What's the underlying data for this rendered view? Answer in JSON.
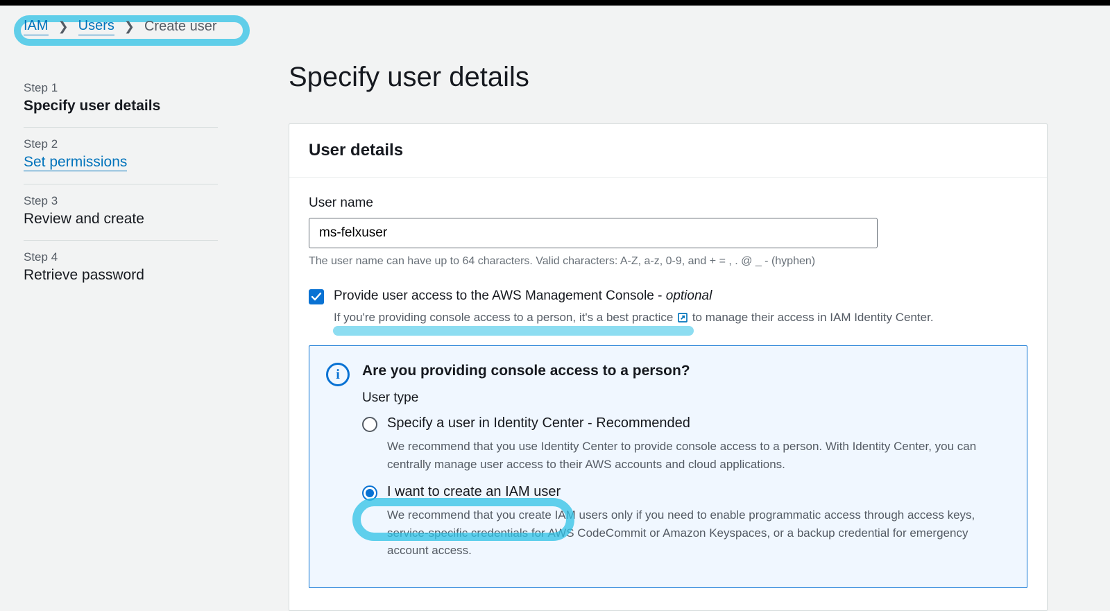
{
  "breadcrumb": {
    "items": [
      "IAM",
      "Users",
      "Create user"
    ]
  },
  "sidebar": {
    "steps": [
      {
        "label": "Step 1",
        "title": "Specify user details"
      },
      {
        "label": "Step 2",
        "title": "Set permissions"
      },
      {
        "label": "Step 3",
        "title": "Review and create"
      },
      {
        "label": "Step 4",
        "title": "Retrieve password"
      }
    ]
  },
  "page": {
    "title": "Specify user details"
  },
  "panel": {
    "header": "User details",
    "username_label": "User name",
    "username_value": "ms-felxuser",
    "username_hint": "The user name can have up to 64 characters. Valid characters: A-Z, a-z, 0-9, and + = , . @ _ - (hyphen)",
    "checkbox_label": "Provide user access to the AWS Management Console - ",
    "checkbox_optional": "optional",
    "checkbox_sub_pre": "If you're providing console access to a person, it's a best practice ",
    "checkbox_sub_post": " to manage their access in IAM Identity Center."
  },
  "info": {
    "title": "Are you providing console access to a person?",
    "subhead": "User type",
    "options": [
      {
        "label": "Specify a user in Identity Center - Recommended",
        "desc": "We recommend that you use Identity Center to provide console access to a person. With Identity Center, you can centrally manage user access to their AWS accounts and cloud applications."
      },
      {
        "label": "I want to create an IAM user",
        "desc": "We recommend that you create IAM users only if you need to enable programmatic access through access keys, service-specific credentials for AWS CodeCommit or Amazon Keyspaces, or a backup credential for emergency account access."
      }
    ]
  }
}
